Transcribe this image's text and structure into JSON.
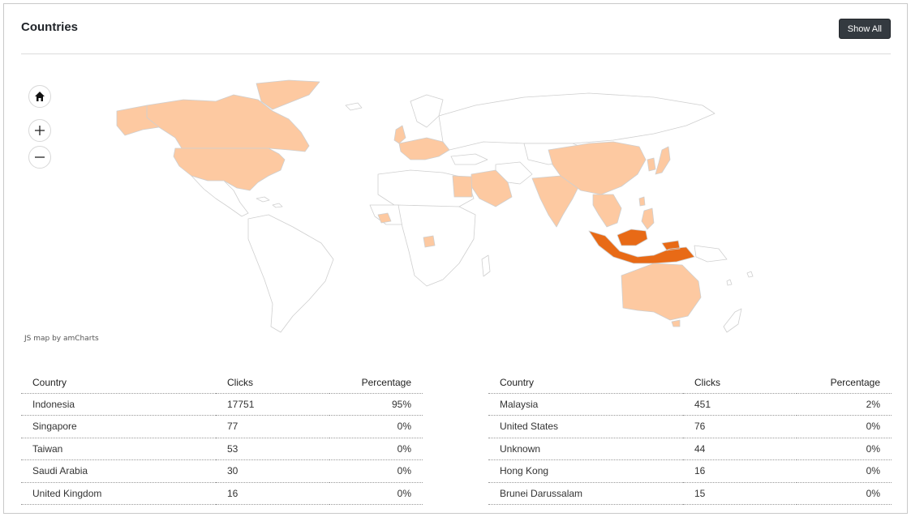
{
  "header": {
    "title": "Countries",
    "show_all_label": "Show All"
  },
  "map": {
    "credit": "JS map by amCharts",
    "colors": {
      "base": "#ffffff",
      "border": "#cfcfcf",
      "light": "#fdc9a1",
      "strong": "#e86a16"
    },
    "controls": [
      "home-icon",
      "zoom-in-icon",
      "zoom-out-icon"
    ]
  },
  "table": {
    "columns": [
      "Country",
      "Clicks",
      "Percentage"
    ],
    "left_rows": [
      {
        "country": "Indonesia",
        "clicks": "17751",
        "percentage": "95%"
      },
      {
        "country": "Singapore",
        "clicks": "77",
        "percentage": "0%"
      },
      {
        "country": "Taiwan",
        "clicks": "53",
        "percentage": "0%"
      },
      {
        "country": "Saudi Arabia",
        "clicks": "30",
        "percentage": "0%"
      },
      {
        "country": "United Kingdom",
        "clicks": "16",
        "percentage": "0%"
      }
    ],
    "right_rows": [
      {
        "country": "Malaysia",
        "clicks": "451",
        "percentage": "2%"
      },
      {
        "country": "United States",
        "clicks": "76",
        "percentage": "0%"
      },
      {
        "country": "Unknown",
        "clicks": "44",
        "percentage": "0%"
      },
      {
        "country": "Hong Kong",
        "clicks": "16",
        "percentage": "0%"
      },
      {
        "country": "Brunei Darussalam",
        "clicks": "15",
        "percentage": "0%"
      }
    ]
  }
}
